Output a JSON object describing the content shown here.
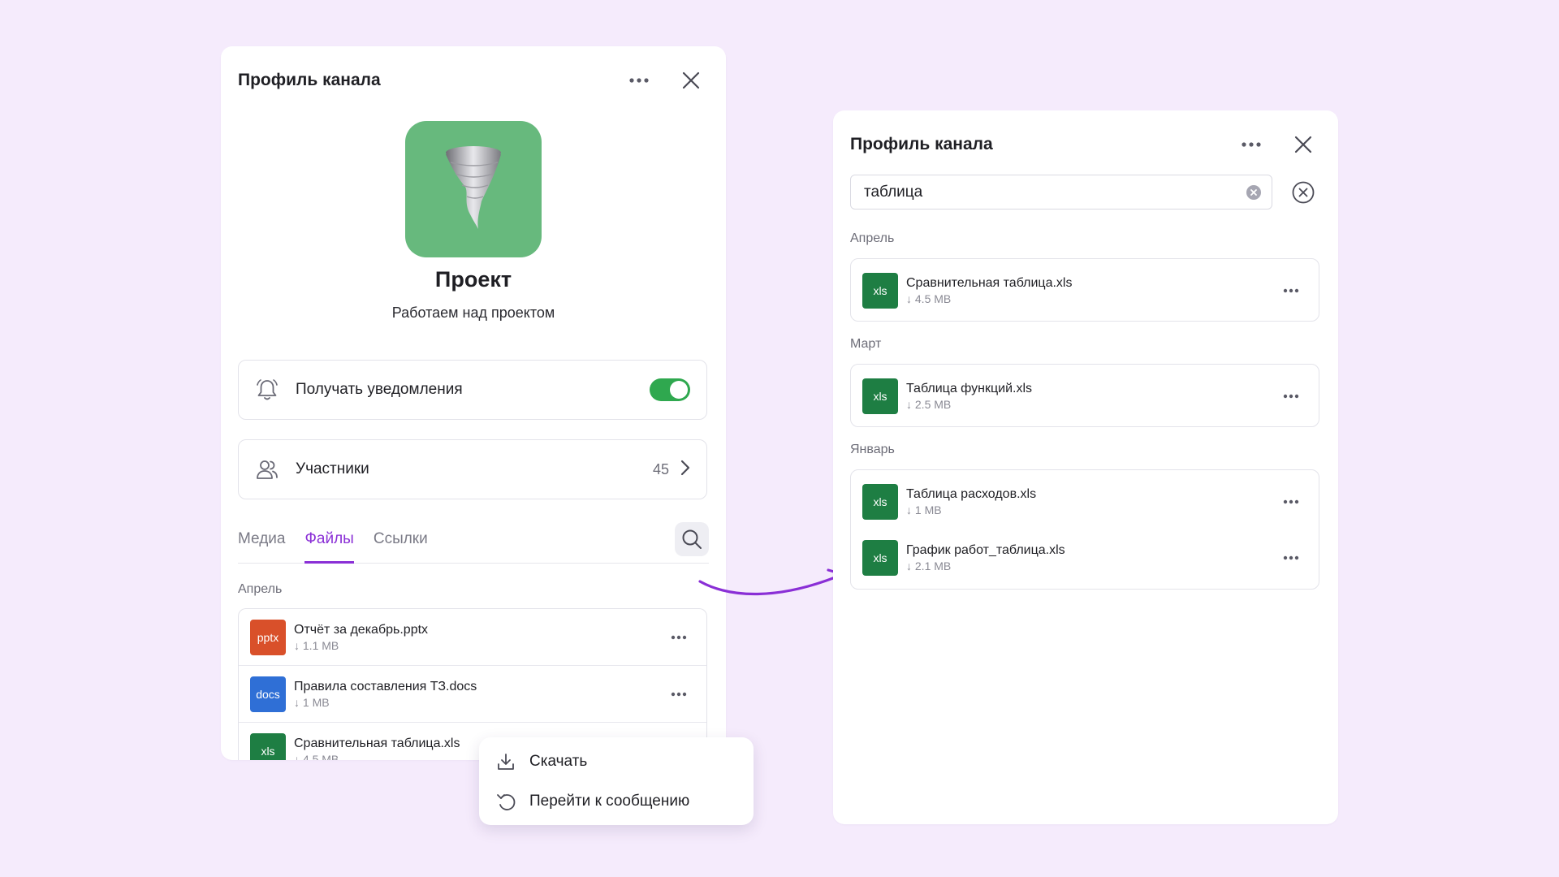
{
  "left_panel": {
    "title": "Профиль канала",
    "channel_name": "Проект",
    "channel_desc": "Работаем над проектом",
    "notifications_label": "Получать уведомления",
    "notifications_on": true,
    "members_label": "Участники",
    "members_count": "45",
    "tabs": [
      {
        "label": "Медиа",
        "active": false
      },
      {
        "label": "Файлы",
        "active": true
      },
      {
        "label": "Ссылки",
        "active": false
      }
    ],
    "section_april": "Апрель",
    "files": [
      {
        "type": "pptx",
        "name": "Отчёт за декабрь.pptx",
        "size": "↓ 1.1 MB",
        "color": "#D9502A"
      },
      {
        "type": "docs",
        "name": "Правила составления ТЗ.docs",
        "size": "↓ 1 MB",
        "color": "#2F6FD6"
      },
      {
        "type": "xls",
        "name": "Сравнительная таблица.xls",
        "size": "↓ 4.5 MB",
        "color": "#1E7E43"
      }
    ]
  },
  "context_menu": {
    "download": "Скачать",
    "goto_message": "Перейти к сообщению"
  },
  "right_panel": {
    "title": "Профиль канала",
    "search_value": "таблица",
    "groups": [
      {
        "label": "Апрель",
        "files": [
          {
            "type": "xls",
            "name": "Сравнительная таблица.xls",
            "size": "↓ 4.5 MB"
          }
        ]
      },
      {
        "label": "Март",
        "files": [
          {
            "type": "xls",
            "name": "Таблица функций.xls",
            "size": "↓ 2.5 MB"
          }
        ]
      },
      {
        "label": "Январь",
        "files": [
          {
            "type": "xls",
            "name": "Таблица расходов.xls",
            "size": "↓ 1 MB"
          },
          {
            "type": "xls",
            "name": "График работ_таблица.xls",
            "size": "↓ 2.1 MB"
          }
        ]
      }
    ]
  },
  "colors": {
    "background": "#F5EBFC",
    "accent": "#8A2FD6",
    "toggle_on": "#2FA84F",
    "xls": "#1E7E43",
    "avatar": "#67B97D"
  }
}
